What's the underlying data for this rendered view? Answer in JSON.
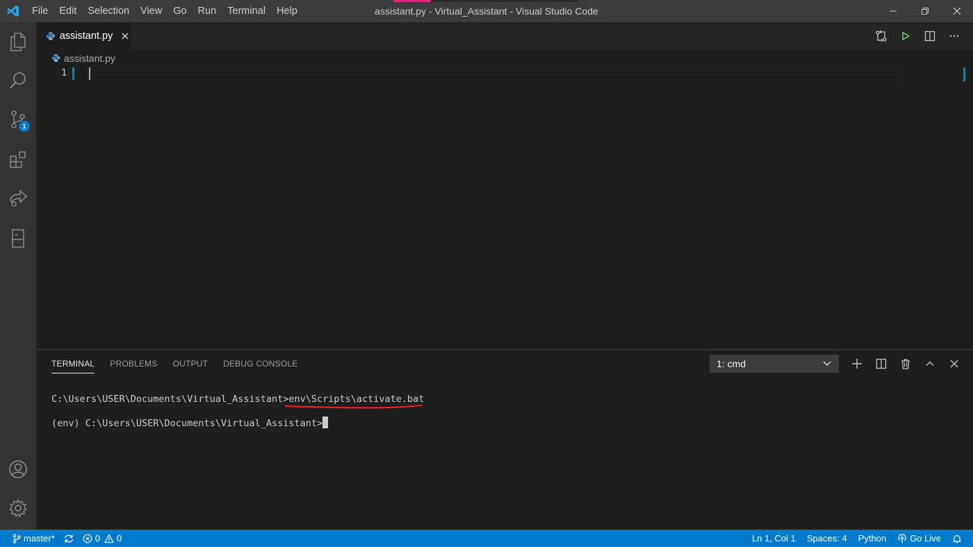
{
  "titlebar": {
    "window_title": "assistant.py - Virtual_Assistant - Visual Studio Code",
    "menu": [
      "File",
      "Edit",
      "Selection",
      "View",
      "Go",
      "Run",
      "Terminal",
      "Help"
    ]
  },
  "activitybar": {
    "items": [
      "explorer-icon",
      "search-icon",
      "source-control-icon",
      "extensions-icon",
      "live-share-icon",
      "remote-explorer-icon"
    ],
    "scm_badge": "1",
    "bottom": [
      "accounts-icon",
      "manage-gear-icon"
    ]
  },
  "tabs": [
    {
      "label": "assistant.py",
      "active": true
    }
  ],
  "breadcrumb": {
    "file": "assistant.py"
  },
  "editor": {
    "line_numbers": [
      "1"
    ]
  },
  "panel": {
    "tabs": [
      "TERMINAL",
      "PROBLEMS",
      "OUTPUT",
      "DEBUG CONSOLE"
    ],
    "terminal_select": "1: cmd",
    "lines": [
      {
        "prompt": "C:\\Users\\USER\\Documents\\Virtual_Assistant>",
        "command": "env\\Scripts\\activate.bat"
      },
      {
        "prompt": "(env) C:\\Users\\USER\\Documents\\Virtual_Assistant>",
        "command": ""
      }
    ]
  },
  "statusbar": {
    "branch": "master*",
    "errors": "0",
    "warnings": "0",
    "position": "Ln 1, Col 1",
    "spaces": "Spaces: 4",
    "language": "Python",
    "go_live": "Go Live"
  },
  "colors": {
    "statusbar_bg": "#007acc",
    "annotation_underline": "#e8202a"
  }
}
